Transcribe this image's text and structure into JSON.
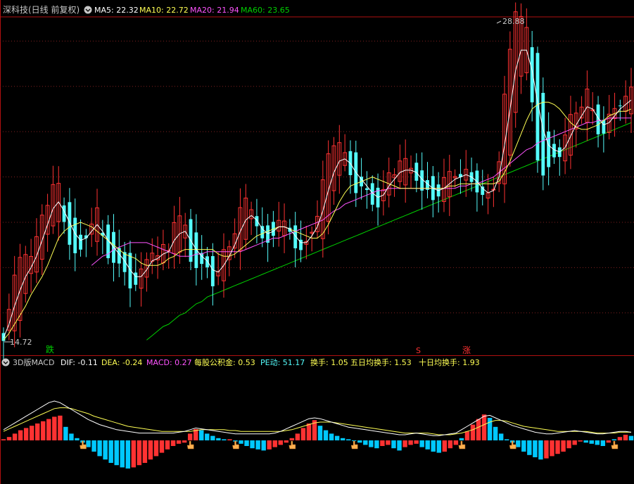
{
  "header": {
    "title": "深科技(日线 前复权)",
    "ma5_label": "MA5: 22.32",
    "ma10_label": "MA10: 22.72",
    "ma20_label": "MA20: 21.94",
    "ma60_label": "MA60: 23.65"
  },
  "macd_header": {
    "title": "3D版MACD",
    "dif_label": "DIF: -0.11",
    "dea_label": "DEA: -0.24",
    "macd_label": "MACD: 0.27",
    "reserve_label": "每股公积金: 0.53",
    "pe_label": "PE动: 51.17",
    "turnover_label": "换手: 1.05",
    "turnover5_label": "五日均换手: 1.53",
    "turnover10_label": "十日均换手: 1.93"
  },
  "annotations": {
    "high_label": "28.88",
    "low_label": "14.72",
    "fall_marker": "跌",
    "s_marker": "S",
    "rise_marker": "涨"
  },
  "colors": {
    "background": "#000000",
    "up": "#ff3232",
    "down": "#54fcfc",
    "ma5": "#ffffff",
    "ma10": "#ffff54",
    "ma20": "#ff54ff",
    "ma60": "#00d000",
    "grid": "#802020",
    "border": "#b01010",
    "title": "#c8c8c8",
    "hist_up": "#ff3232",
    "hist_down": "#00c8ff"
  },
  "icons": [
    "settings-icon",
    "hand-pointer-icon"
  ],
  "chart_data": [
    {
      "type": "candlestick",
      "ylim": [
        14.5,
        29.5
      ],
      "gridlines": [
        16,
        18,
        20,
        22,
        24,
        26,
        28
      ],
      "price_high": 28.88,
      "price_low": 14.72,
      "series": [
        {
          "name": "MA5",
          "color": "#ffffff",
          "values": [
            14.9,
            15.5,
            16.3,
            17.0,
            17.6,
            18.0,
            18.5,
            19.2,
            19.9,
            20.6,
            20.9,
            20.5,
            20.0,
            19.5,
            19.2,
            19.3,
            19.6,
            19.9,
            19.6,
            19.2,
            18.9,
            18.6,
            18.3,
            17.9,
            17.6,
            17.6,
            17.9,
            18.3,
            18.4,
            18.6,
            18.7,
            19.2,
            19.5,
            19.6,
            19.2,
            18.8,
            18.5,
            18.3,
            17.9,
            17.8,
            18.1,
            18.5,
            19.0,
            19.6,
            20.1,
            20.3,
            20.1,
            19.7,
            19.5,
            19.6,
            19.8,
            19.8,
            19.7,
            19.4,
            19.1,
            19.1,
            19.4,
            19.8,
            20.5,
            21.4,
            22.2,
            22.7,
            22.8,
            22.6,
            22.2,
            21.9,
            21.6,
            21.3,
            21.1,
            21.2,
            21.6,
            21.9,
            22.2,
            22.3,
            22.3,
            22.2,
            21.9,
            21.7,
            21.5,
            21.4,
            21.5,
            21.7,
            21.9,
            22.0,
            22.1,
            22.0,
            21.8,
            21.5,
            21.3,
            21.4,
            22.0,
            23.4,
            25.0,
            26.7,
            27.6,
            27.6,
            26.7,
            25.3,
            24.1,
            23.4,
            23.2,
            23.1,
            23.3,
            23.8,
            24.3,
            24.7,
            25.1,
            25.0,
            24.6,
            24.3,
            24.4,
            24.7,
            25.0,
            25.2,
            25.4
          ]
        },
        {
          "name": "MA10",
          "color": "#ffff54",
          "values": [
            14.8,
            15.1,
            15.5,
            15.9,
            16.3,
            16.8,
            17.2,
            17.6,
            18.1,
            18.7,
            19.3,
            19.6,
            19.8,
            19.9,
            20.0,
            19.9,
            19.8,
            19.6,
            19.4,
            19.2,
            19.0,
            18.8,
            18.6,
            18.5,
            18.4,
            18.2,
            18.1,
            18.1,
            18.1,
            18.2,
            18.4,
            18.5,
            18.7,
            18.8,
            18.8,
            18.8,
            18.8,
            18.8,
            18.8,
            18.6,
            18.5,
            18.5,
            18.6,
            18.8,
            19.0,
            19.2,
            19.4,
            19.5,
            19.6,
            19.7,
            19.8,
            19.8,
            19.7,
            19.6,
            19.5,
            19.4,
            19.3,
            19.3,
            19.5,
            19.9,
            20.4,
            20.9,
            21.3,
            21.6,
            21.7,
            21.8,
            21.9,
            22.0,
            21.9,
            21.8,
            21.7,
            21.6,
            21.5,
            21.5,
            21.5,
            21.5,
            21.5,
            21.5,
            21.5,
            21.5,
            21.5,
            21.6,
            21.6,
            21.7,
            21.7,
            21.7,
            21.7,
            21.7,
            21.7,
            21.7,
            21.8,
            22.2,
            22.7,
            23.3,
            23.9,
            24.5,
            25.0,
            25.2,
            25.3,
            25.3,
            25.2,
            25.0,
            24.7,
            24.4,
            24.2,
            24.1,
            24.1,
            24.2,
            24.3,
            24.5,
            24.7,
            24.8,
            24.9,
            24.9,
            25.0
          ]
        },
        {
          "name": "MA20",
          "color": "#ff54ff",
          "values": [
            null,
            null,
            null,
            null,
            null,
            null,
            null,
            null,
            null,
            null,
            null,
            null,
            null,
            null,
            null,
            null,
            18.1,
            18.3,
            18.5,
            18.6,
            18.8,
            18.9,
            19.0,
            19.1,
            19.1,
            19.1,
            19.1,
            19.0,
            18.9,
            18.8,
            18.7,
            18.6,
            18.5,
            18.5,
            18.5,
            18.6,
            18.6,
            18.7,
            18.7,
            18.7,
            18.7,
            18.7,
            18.7,
            18.7,
            18.8,
            18.9,
            19.0,
            19.1,
            19.2,
            19.3,
            19.3,
            19.4,
            19.5,
            19.6,
            19.7,
            19.8,
            19.9,
            20.0,
            20.1,
            20.3,
            20.5,
            20.6,
            20.8,
            20.9,
            21.0,
            21.1,
            21.2,
            21.3,
            21.4,
            21.4,
            21.5,
            21.5,
            21.5,
            21.5,
            21.5,
            21.5,
            21.5,
            21.5,
            21.5,
            21.5,
            21.5,
            21.5,
            21.5,
            21.6,
            21.6,
            21.7,
            21.7,
            21.8,
            21.9,
            22.0,
            22.2,
            22.4,
            22.6,
            22.8,
            23.0,
            23.2,
            23.3,
            23.5,
            23.6,
            23.7,
            23.8,
            23.9,
            24.0,
            24.1,
            24.2,
            24.3,
            24.4,
            24.4,
            24.5,
            24.5,
            24.6,
            24.6,
            24.6,
            24.6,
            24.6
          ]
        },
        {
          "name": "MA60",
          "color": "#00d000",
          "values": [
            null,
            null,
            null,
            null,
            null,
            null,
            null,
            null,
            null,
            null,
            null,
            null,
            null,
            null,
            null,
            null,
            null,
            null,
            null,
            null,
            null,
            null,
            null,
            null,
            null,
            null,
            14.8,
            15.0,
            15.2,
            15.4,
            15.5,
            15.7,
            15.9,
            16.0,
            16.2,
            16.4,
            16.5,
            16.7,
            16.8,
            16.9,
            17.0,
            17.1,
            17.2,
            17.3,
            17.4,
            17.5,
            17.6,
            17.7,
            17.8,
            17.9,
            18.0,
            18.1,
            18.2,
            18.3,
            18.4,
            18.5,
            18.6,
            18.7,
            18.8,
            18.9,
            19.0,
            19.1,
            19.2,
            19.3,
            19.4,
            19.5,
            19.6,
            19.7,
            19.8,
            19.9,
            20.0,
            20.1,
            20.2,
            20.3,
            20.4,
            20.5,
            20.6,
            20.7,
            20.8,
            20.9,
            21.0,
            21.1,
            21.2,
            21.3,
            21.4,
            21.5,
            21.6,
            21.7,
            21.8,
            21.9,
            22.0,
            22.1,
            22.2,
            22.3,
            22.4,
            22.5,
            22.6,
            22.7,
            22.8,
            22.9,
            23.0,
            23.1,
            23.2,
            23.3,
            23.4,
            23.5,
            23.6,
            23.7,
            23.8,
            23.9,
            24.0,
            24.1,
            24.2,
            24.3,
            24.4
          ]
        }
      ]
    },
    {
      "type": "bar",
      "title": "3D版MACD",
      "series": [
        {
          "name": "MACD",
          "values": [
            0.05,
            0.15,
            0.3,
            0.45,
            0.55,
            0.65,
            0.75,
            0.85,
            0.95,
            1.05,
            1.1,
            0.6,
            0.3,
            0.1,
            -0.1,
            -0.3,
            -0.5,
            -0.7,
            -0.85,
            -1.0,
            -1.1,
            -1.2,
            -1.25,
            -1.2,
            -1.1,
            -1.0,
            -0.85,
            -0.7,
            -0.55,
            -0.4,
            -0.25,
            -0.15,
            -0.1,
            0.3,
            0.5,
            0.45,
            0.3,
            0.2,
            0.1,
            0.05,
            0.05,
            -0.05,
            -0.15,
            -0.25,
            -0.35,
            -0.4,
            -0.45,
            -0.4,
            -0.3,
            -0.2,
            -0.1,
            0.1,
            0.3,
            0.55,
            0.75,
            0.9,
            0.65,
            0.45,
            0.3,
            0.2,
            0.1,
            0.05,
            0.0,
            -0.1,
            -0.2,
            -0.3,
            -0.35,
            -0.25,
            -0.2,
            -0.35,
            -0.45,
            -0.3,
            -0.2,
            -0.15,
            -0.3,
            -0.4,
            -0.5,
            -0.55,
            -0.5,
            -0.35,
            -0.2,
            0.1,
            0.4,
            0.7,
            0.95,
            1.15,
            1.0,
            0.6,
            0.3,
            0.05,
            -0.1,
            -0.3,
            -0.5,
            -0.65,
            -0.75,
            -0.85,
            -0.8,
            -0.7,
            -0.6,
            -0.5,
            -0.35,
            -0.2,
            -0.05,
            -0.1,
            -0.15,
            -0.2,
            -0.25,
            -0.1,
            0.05,
            0.15,
            0.25,
            0.2
          ]
        },
        {
          "name": "DIF",
          "values": [
            0.3,
            0.5,
            0.7,
            0.9,
            1.1,
            1.3,
            1.5,
            1.7,
            1.9,
            2.0,
            1.9,
            1.7,
            1.5,
            1.3,
            1.1,
            0.9,
            0.75,
            0.6,
            0.5,
            0.4,
            0.3,
            0.25,
            0.2,
            0.15,
            0.1,
            0.1,
            0.1,
            0.1,
            0.1,
            0.1,
            0.1,
            0.15,
            0.2,
            0.3,
            0.4,
            0.35,
            0.3,
            0.25,
            0.2,
            0.15,
            0.1,
            0.05,
            0.05,
            0.05,
            0.05,
            0.05,
            0.05,
            0.05,
            0.1,
            0.2,
            0.35,
            0.5,
            0.65,
            0.8,
            0.95,
            1.0,
            0.95,
            0.85,
            0.75,
            0.65,
            0.55,
            0.45,
            0.4,
            0.35,
            0.3,
            0.25,
            0.2,
            0.15,
            0.1,
            0.05,
            0.0,
            0.0,
            0.05,
            0.1,
            0.05,
            0.0,
            -0.05,
            -0.05,
            0.0,
            0.05,
            0.1,
            0.3,
            0.5,
            0.7,
            0.9,
            1.1,
            1.15,
            1.0,
            0.85,
            0.7,
            0.55,
            0.45,
            0.35,
            0.25,
            0.15,
            0.1,
            0.05,
            0.05,
            0.1,
            0.15,
            0.2,
            0.25,
            0.2,
            0.15,
            0.1,
            0.05,
            0.05,
            0.1,
            0.15,
            0.2,
            0.2,
            0.15
          ]
        },
        {
          "name": "DEA",
          "values": [
            0.2,
            0.35,
            0.5,
            0.65,
            0.8,
            0.95,
            1.1,
            1.25,
            1.4,
            1.55,
            1.6,
            1.6,
            1.55,
            1.45,
            1.35,
            1.25,
            1.1,
            1.0,
            0.9,
            0.8,
            0.7,
            0.6,
            0.5,
            0.45,
            0.4,
            0.35,
            0.3,
            0.25,
            0.2,
            0.2,
            0.2,
            0.2,
            0.2,
            0.2,
            0.25,
            0.3,
            0.3,
            0.3,
            0.3,
            0.3,
            0.25,
            0.25,
            0.2,
            0.2,
            0.2,
            0.2,
            0.2,
            0.2,
            0.2,
            0.2,
            0.25,
            0.3,
            0.4,
            0.5,
            0.6,
            0.7,
            0.75,
            0.75,
            0.75,
            0.7,
            0.65,
            0.6,
            0.55,
            0.5,
            0.45,
            0.4,
            0.35,
            0.3,
            0.25,
            0.2,
            0.15,
            0.1,
            0.1,
            0.1,
            0.1,
            0.1,
            0.05,
            0.0,
            0.0,
            0.0,
            0.05,
            0.1,
            0.2,
            0.3,
            0.45,
            0.6,
            0.75,
            0.85,
            0.85,
            0.8,
            0.7,
            0.6,
            0.5,
            0.45,
            0.4,
            0.35,
            0.3,
            0.25,
            0.2,
            0.2,
            0.2,
            0.2,
            0.2,
            0.2,
            0.15,
            0.1,
            0.1,
            0.1,
            0.1,
            0.15,
            0.15,
            0.15
          ]
        }
      ]
    }
  ]
}
